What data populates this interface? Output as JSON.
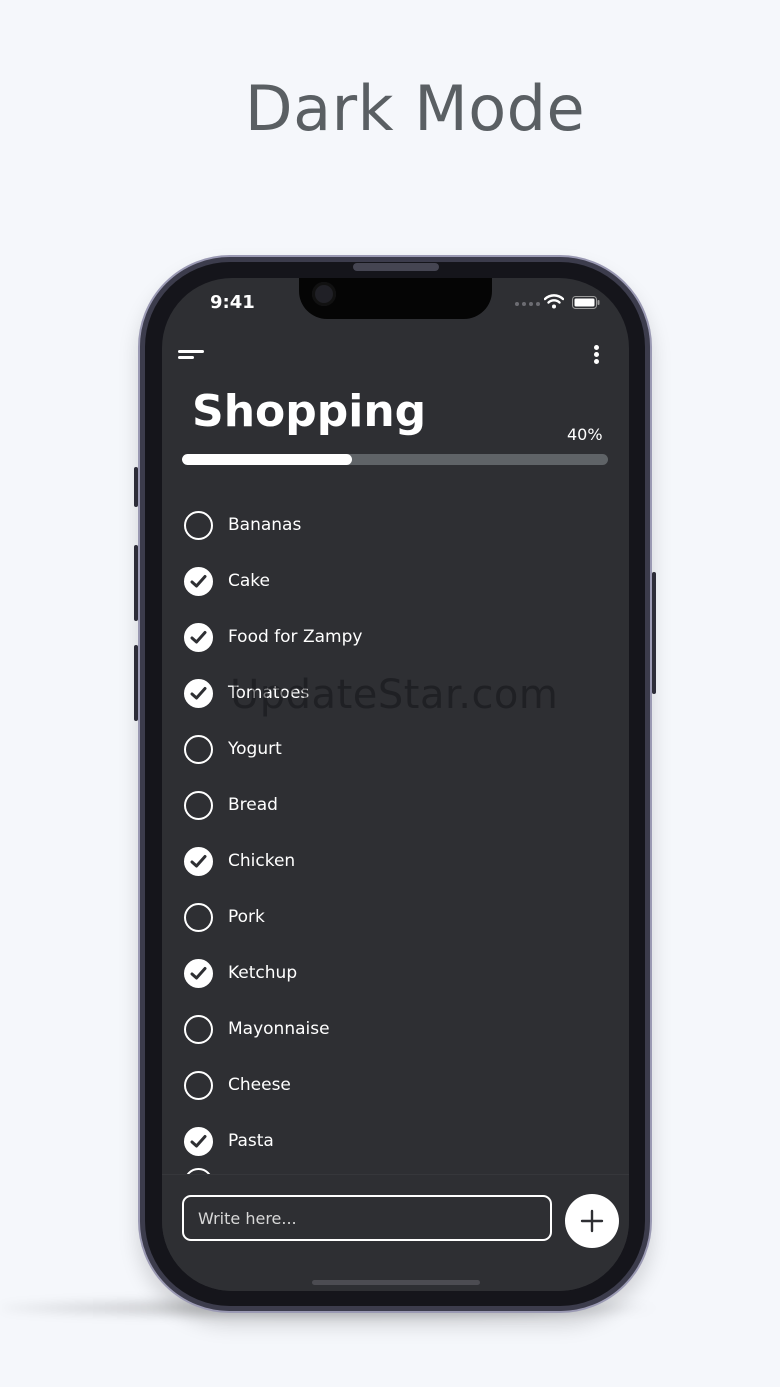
{
  "headline": "Dark Mode",
  "status_bar": {
    "time": "9:41"
  },
  "app": {
    "title": "Shopping",
    "progress_label": "40%",
    "progress_fraction": 0.4,
    "items": [
      {
        "label": "Bananas",
        "checked": false
      },
      {
        "label": "Cake",
        "checked": true
      },
      {
        "label": "Food for Zampy",
        "checked": true
      },
      {
        "label": "Tomatoes",
        "checked": true
      },
      {
        "label": "Yogurt",
        "checked": false
      },
      {
        "label": "Bread",
        "checked": false
      },
      {
        "label": "Chicken",
        "checked": true
      },
      {
        "label": "Pork",
        "checked": false
      },
      {
        "label": "Ketchup",
        "checked": true
      },
      {
        "label": "Mayonnaise",
        "checked": false
      },
      {
        "label": "Cheese",
        "checked": false
      },
      {
        "label": "Pasta",
        "checked": true
      }
    ],
    "input_placeholder": "Write here..."
  },
  "watermark": "UpdateStar.com",
  "colors": {
    "background": "#f5f7fb",
    "screen": "#2e2f33",
    "accent": "#ffffff",
    "track": "#5f6367"
  }
}
